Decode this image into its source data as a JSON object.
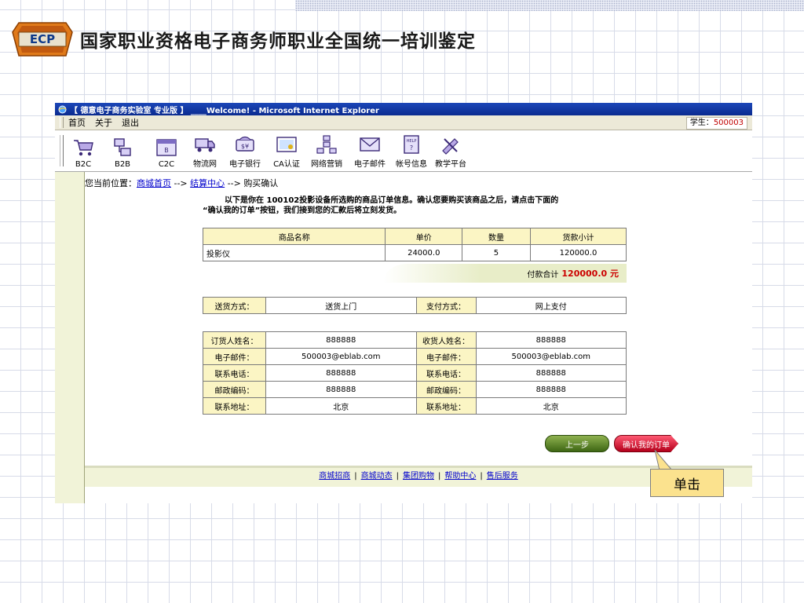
{
  "slide": {
    "title": "国家职业资格电子商务师职业全国统一培训鉴定",
    "logo_text": "ECP"
  },
  "window": {
    "title": "【 德意电子商务实验室 专业版 】 ____Welcome! - Microsoft Internet Explorer"
  },
  "menubar": {
    "items": [
      "首页",
      "关于",
      "退出"
    ],
    "student_label": "学生：",
    "student_id": "500003"
  },
  "toolbar": {
    "items": [
      {
        "label": "B2C",
        "icon": "shopping-cart-icon"
      },
      {
        "label": "B2B",
        "icon": "network-icon"
      },
      {
        "label": "C2C",
        "icon": "window-icon"
      },
      {
        "label": "物流网",
        "icon": "truck-icon"
      },
      {
        "label": "电子银行",
        "icon": "money-icon"
      },
      {
        "label": "CA认证",
        "icon": "certificate-icon"
      },
      {
        "label": "网络营销",
        "icon": "sitemap-icon"
      },
      {
        "label": "电子邮件",
        "icon": "email-icon"
      },
      {
        "label": "帐号信息",
        "icon": "help-book-icon"
      },
      {
        "label": "教学平台",
        "icon": "tools-icon"
      }
    ]
  },
  "breadcrumb": {
    "prefix": "您当前位置：",
    "link1": "商城首页",
    "sep1": " --> ",
    "link2": "结算中心",
    "sep2": " --> ",
    "current": "购买确认"
  },
  "intro": {
    "line1": "以下是你在 100102投影设备所选购的商品订单信息。确认您要购买该商品之后，请点击下面的",
    "line2": "“确认我的订单”按钮，我们接到您的汇款后将立刻发货。"
  },
  "order_table": {
    "headers": [
      "商品名称",
      "单价",
      "数量",
      "货款小计"
    ],
    "rows": [
      [
        "投影仪",
        "24000.0",
        "5",
        "120000.0"
      ]
    ],
    "total_label": "付款合计",
    "total_value": "120000.0 元"
  },
  "payment": {
    "ship_label": "送货方式：",
    "ship_value": "送货上门",
    "pay_label": "支付方式：",
    "pay_value": "网上支付"
  },
  "contact": {
    "rows": [
      {
        "l1": "订货人姓名：",
        "v1": "888888",
        "l2": "收货人姓名：",
        "v2": "888888"
      },
      {
        "l1": "电子邮件：",
        "v1": "500003@eblab.com",
        "l2": "电子邮件：",
        "v2": "500003@eblab.com"
      },
      {
        "l1": "联系电话：",
        "v1": "888888",
        "l2": "联系电话：",
        "v2": "888888"
      },
      {
        "l1": "邮政编码：",
        "v1": "888888",
        "l2": "邮政编码：",
        "v2": "888888"
      },
      {
        "l1": "联系地址：",
        "v1": "北京",
        "l2": "联系地址：",
        "v2": "北京"
      }
    ]
  },
  "buttons": {
    "prev": "上一步",
    "confirm": "确认我的订单"
  },
  "footer": {
    "links": [
      "商城招商",
      "商城动态",
      "集团购物",
      "帮助中心",
      "售后服务"
    ],
    "separator": "|"
  },
  "callout": {
    "text": "单击"
  },
  "colors": {
    "titlebar": "#0a2a8f",
    "header_cell": "#fbf5c4",
    "total_amount": "#cc0000",
    "callout_bg": "#fbe28e"
  }
}
